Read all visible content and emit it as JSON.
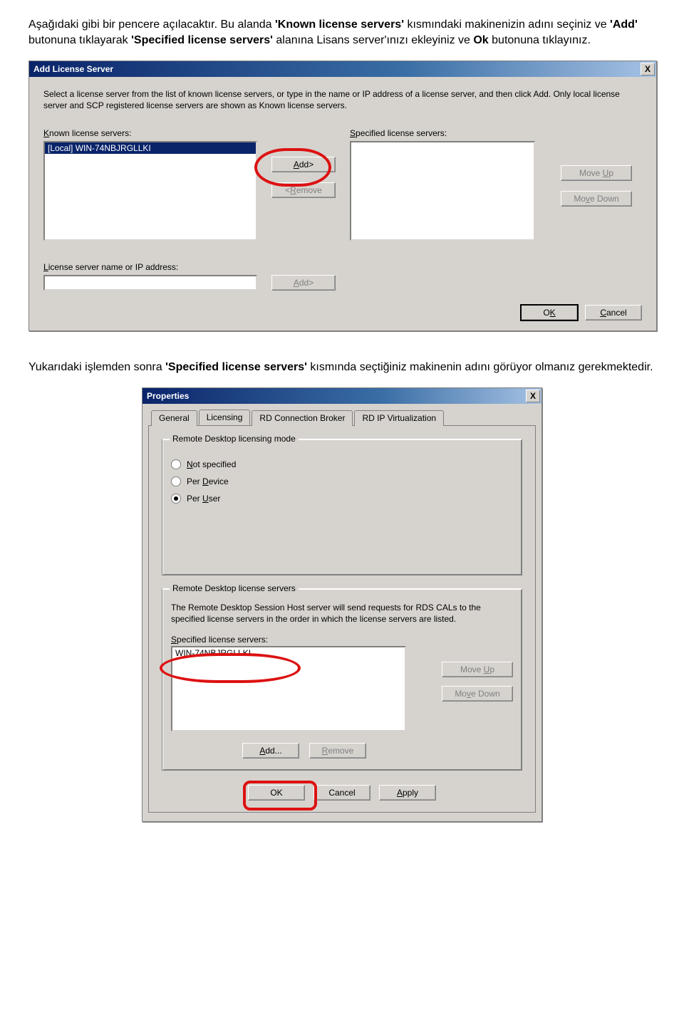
{
  "doc": {
    "para1_a": "Aşağıdaki gibi bir pencere açılacaktır. Bu alanda ",
    "para1_b": "'Known license servers'",
    "para1_c": " kısmındaki makinenizin adını seçiniz  ve ",
    "para1_d": "'Add'",
    "para1_e": " butonuna tıklayarak ",
    "para1_f": "'Specified license servers'",
    "para1_g": " alanına Lisans server'ınızı ekleyiniz ve ",
    "para1_h": "Ok",
    "para1_i": " butonuna tıklayınız.",
    "para2_a": "Yukarıdaki işlemden sonra ",
    "para2_b": "'Specified license servers'",
    "para2_c": " kısmında seçtiğiniz makinenin adını görüyor olmanız gerekmektedir."
  },
  "dialog1": {
    "title": "Add License Server",
    "close_x": "X",
    "instructions": "Select a license server from the list of known license servers, or type in the name or IP address of a license server, and then click Add. Only local license server and SCP registered license servers are shown as Known license servers.",
    "known_label_pre": "K",
    "known_label_rest": "nown license servers:",
    "specified_label_pre": "S",
    "specified_label_rest": "pecified license servers:",
    "known_item": "[Local] WIN-74NBJRGLLKI",
    "btn_add": "Add>",
    "btn_add_u": "A",
    "btn_remove_pre": "<",
    "btn_remove_u": "R",
    "btn_remove_rest": "emove",
    "btn_moveup_pre": "Move ",
    "btn_moveup_u": "U",
    "btn_moveup_rest": "p",
    "btn_movedown_pre": "Mo",
    "btn_movedown_u": "v",
    "btn_movedown_rest": "e Down",
    "ip_label_pre": "L",
    "ip_label_rest": "icense server name or IP address:",
    "btn_add2": "Add>",
    "btn_add2_u": "A",
    "btn_ok_pre": "O",
    "btn_ok_u": "K",
    "btn_cancel_u": "C",
    "btn_cancel_rest": "ancel"
  },
  "dialog2": {
    "title": "Properties",
    "close_x": "X",
    "tabs": {
      "general": "General",
      "licensing": "Licensing",
      "broker": "RD Connection Broker",
      "ipvirt": "RD IP Virtualization"
    },
    "group1_legend": "Remote Desktop licensing mode",
    "r_notspec_u": "N",
    "r_notspec_rest": "ot specified",
    "r_perdevice_pre": "Per ",
    "r_perdevice_u": "D",
    "r_perdevice_rest": "evice",
    "r_peruser_pre": "Per ",
    "r_peruser_u": "U",
    "r_peruser_rest": "ser",
    "group2_legend": "Remote Desktop license servers",
    "group2_text": "The Remote Desktop Session Host server will send requests for RDS CALs to the specified license servers in the order in which the license servers are listed.",
    "spec_label_pre": "S",
    "spec_label_rest": "pecified license servers:",
    "list_item": "WIN-74NBJRGLLKI",
    "btn_moveup_pre": "Move ",
    "btn_moveup_u": "U",
    "btn_moveup_rest": "p",
    "btn_movedown_pre": "Mo",
    "btn_movedown_u": "v",
    "btn_movedown_rest": "e Down",
    "btn_add_u": "A",
    "btn_add_rest": "dd...",
    "btn_remove_u": "R",
    "btn_remove_rest": "emove",
    "btn_ok": "OK",
    "btn_cancel": "Cancel",
    "btn_apply_u": "A",
    "btn_apply_rest": "pply"
  }
}
